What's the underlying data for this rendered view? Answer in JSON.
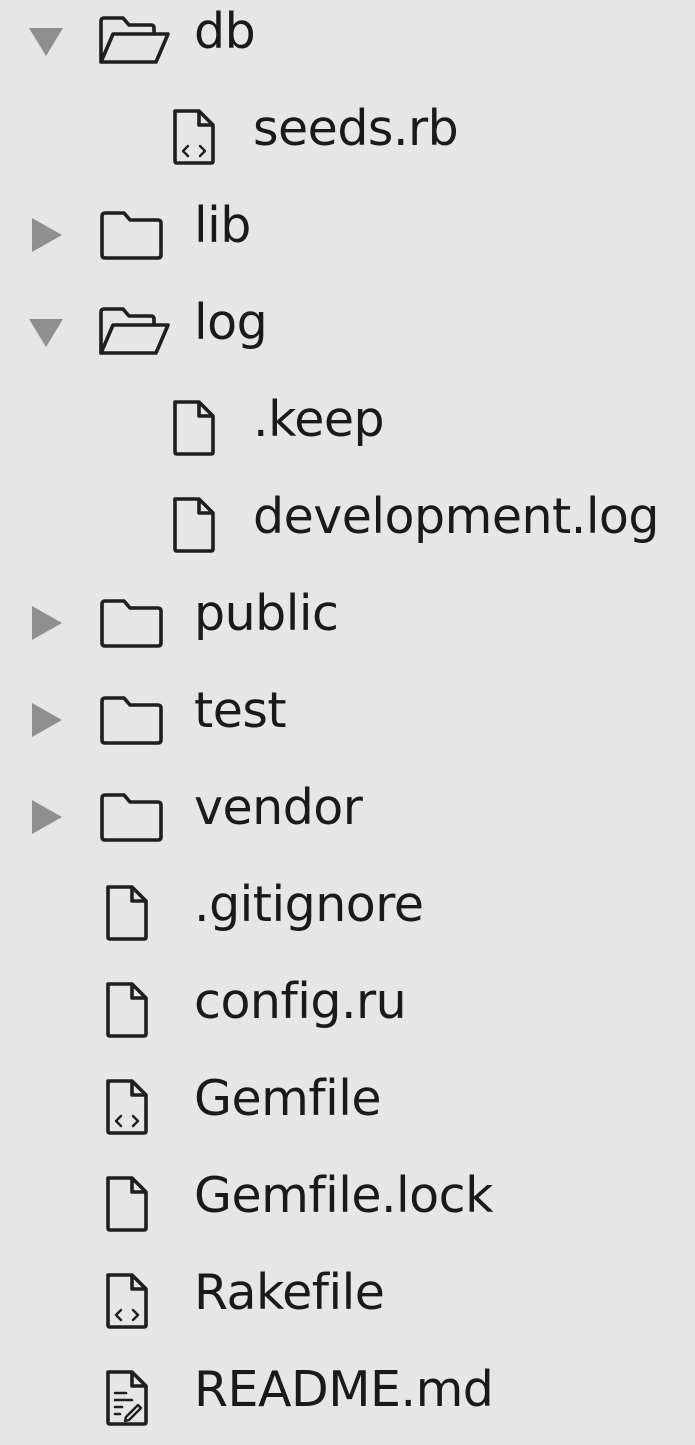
{
  "file_tree": {
    "items": [
      {
        "name": "db",
        "kind": "folder",
        "state": "expanded",
        "depth": 0,
        "icon": "folder-open-icon"
      },
      {
        "name": "seeds.rb",
        "kind": "file",
        "depth": 1,
        "icon": "code-file-icon"
      },
      {
        "name": "lib",
        "kind": "folder",
        "state": "collapsed",
        "depth": 0,
        "icon": "folder-icon"
      },
      {
        "name": "log",
        "kind": "folder",
        "state": "expanded",
        "depth": 0,
        "icon": "folder-open-icon"
      },
      {
        "name": ".keep",
        "kind": "file",
        "depth": 1,
        "icon": "file-icon"
      },
      {
        "name": "development.log",
        "kind": "file",
        "depth": 1,
        "icon": "file-icon"
      },
      {
        "name": "public",
        "kind": "folder",
        "state": "collapsed",
        "depth": 0,
        "icon": "folder-icon"
      },
      {
        "name": "test",
        "kind": "folder",
        "state": "collapsed",
        "depth": 0,
        "icon": "folder-icon"
      },
      {
        "name": "vendor",
        "kind": "folder",
        "state": "collapsed",
        "depth": 0,
        "icon": "folder-icon"
      },
      {
        "name": ".gitignore",
        "kind": "file",
        "depth": 0,
        "icon": "file-icon"
      },
      {
        "name": "config.ru",
        "kind": "file",
        "depth": 0,
        "icon": "file-icon"
      },
      {
        "name": "Gemfile",
        "kind": "file",
        "depth": 0,
        "icon": "code-file-icon"
      },
      {
        "name": "Gemfile.lock",
        "kind": "file",
        "depth": 0,
        "icon": "file-icon"
      },
      {
        "name": "Rakefile",
        "kind": "file",
        "depth": 0,
        "icon": "code-file-icon"
      },
      {
        "name": "README.md",
        "kind": "file",
        "depth": 0,
        "icon": "markdown-file-icon"
      }
    ]
  },
  "colors": {
    "background": "#e6e6e6",
    "text": "#1a1a1a",
    "icon_stroke": "#1f1f1f",
    "disclosure_arrow": "#8f8f8f"
  }
}
